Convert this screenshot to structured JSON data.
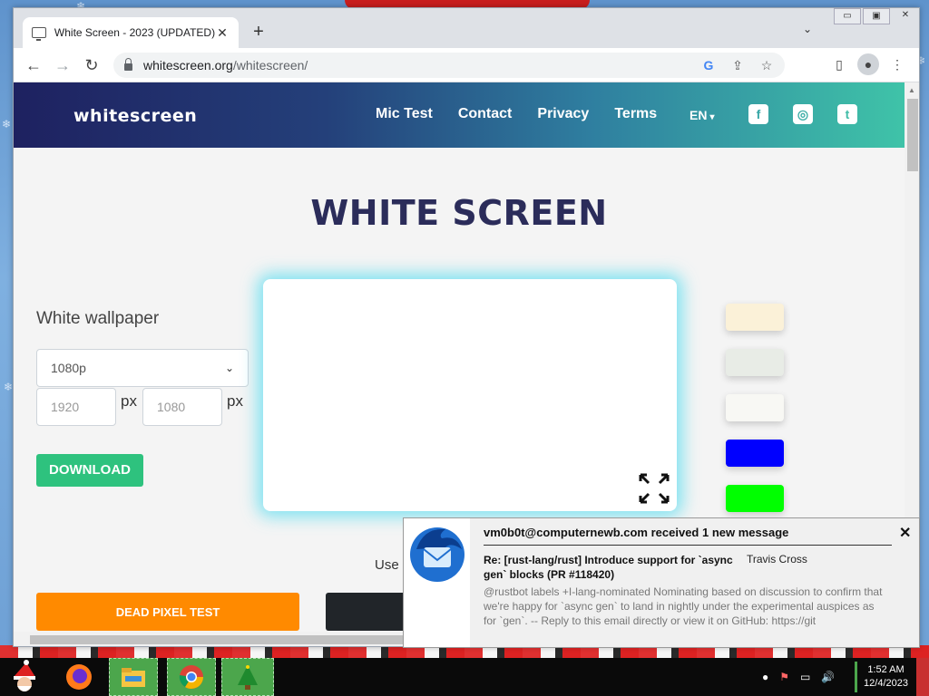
{
  "browser": {
    "tab_title": "White Screen - 2023 (UPDATED)",
    "tab_close": "✕",
    "new_tab": "+",
    "tab_menu": "⌄",
    "url_host": "whitescreen.org",
    "url_path": "/whitescreen/",
    "back": "←",
    "forward": "→",
    "reload": "↻",
    "win_minimize": "▭",
    "win_restore": "▣",
    "win_close": "✕"
  },
  "site": {
    "logo": "whitescreen",
    "nav": [
      "Mic Test",
      "Contact",
      "Privacy",
      "Terms"
    ],
    "language": "EN",
    "social": {
      "facebook": "f",
      "instagram": "◎",
      "twitter": "t"
    }
  },
  "main": {
    "title": "WHITE SCREEN",
    "subtitle": "White wallpaper",
    "resolution_selected": "1080p",
    "width_placeholder": "1920",
    "height_placeholder": "1080",
    "px_label": "px",
    "download_label": "DOWNLOAD",
    "use_text": "Use",
    "dead_pixel_label": "DEAD PIXEL TEST",
    "swatches": [
      "#fbf1d8",
      "#e8ece6",
      "#f8f8f4",
      "#0000ff",
      "#00ff00"
    ],
    "preview_color": "#ffffff"
  },
  "notification": {
    "sender": "vm0b0t@computernewb.com received 1 new message",
    "subject": "Re: [rust-lang/rust] Introduce support for `async gen` blocks (PR #118420)",
    "from": "Travis Cross",
    "body": "@rustbot labels +I-lang-nominated Nominating based on discussion to confirm that we're happy for `async gen` to land in nightly under the experimental auspices as for `gen`. -- Reply to this email directly or view it on GitHub: https://git",
    "close": "✕"
  },
  "taskbar": {
    "time": "1:52 AM",
    "date": "12/4/2023"
  }
}
